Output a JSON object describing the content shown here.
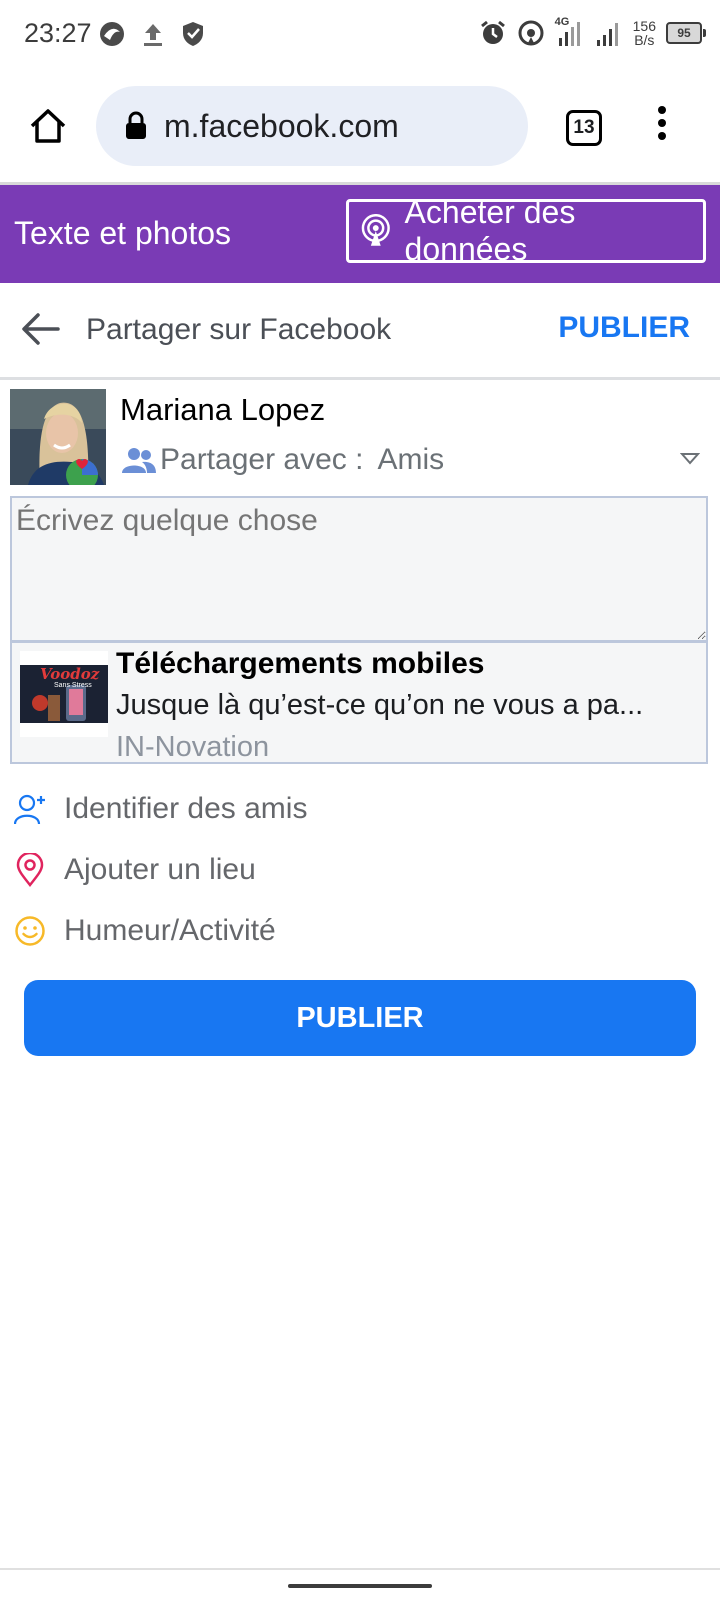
{
  "status_bar": {
    "time": "23:27",
    "network": "4G",
    "speed_value": "156",
    "speed_unit": "B/s",
    "battery": "95"
  },
  "browser": {
    "url": "m.facebook.com",
    "tab_count": "13",
    "icons": [
      "home-icon",
      "lock-icon",
      "tabs-icon",
      "more-vert-icon"
    ]
  },
  "banner": {
    "label": "Texte et photos",
    "buy_button": "Acheter des données",
    "color": "#7a3bb5"
  },
  "share_header": {
    "title": "Partager sur Facebook",
    "publish": "PUBLIER"
  },
  "user": {
    "name": "Mariana Lopez",
    "audience_label": "Partager avec :",
    "audience_value": "Amis"
  },
  "composer": {
    "placeholder": "Écrivez quelque chose",
    "link": {
      "title": "Téléchargements mobiles",
      "description": "Jusque là qu’est-ce qu’on ne vous a pa...",
      "source": "IN-Novation",
      "thumbnail_text": "Voodoz",
      "thumbnail_subtext": "Sans Stress"
    }
  },
  "actions": [
    {
      "label": "Identifier des amis",
      "icon": "tag-friends-icon",
      "color": "#1877f2"
    },
    {
      "label": "Ajouter un lieu",
      "icon": "location-pin-icon",
      "color": "#e0245e"
    },
    {
      "label": "Humeur/Activité",
      "icon": "smiley-icon",
      "color": "#f7b928"
    }
  ],
  "publish_button": "PUBLIER",
  "accent_color": "#1877f2"
}
